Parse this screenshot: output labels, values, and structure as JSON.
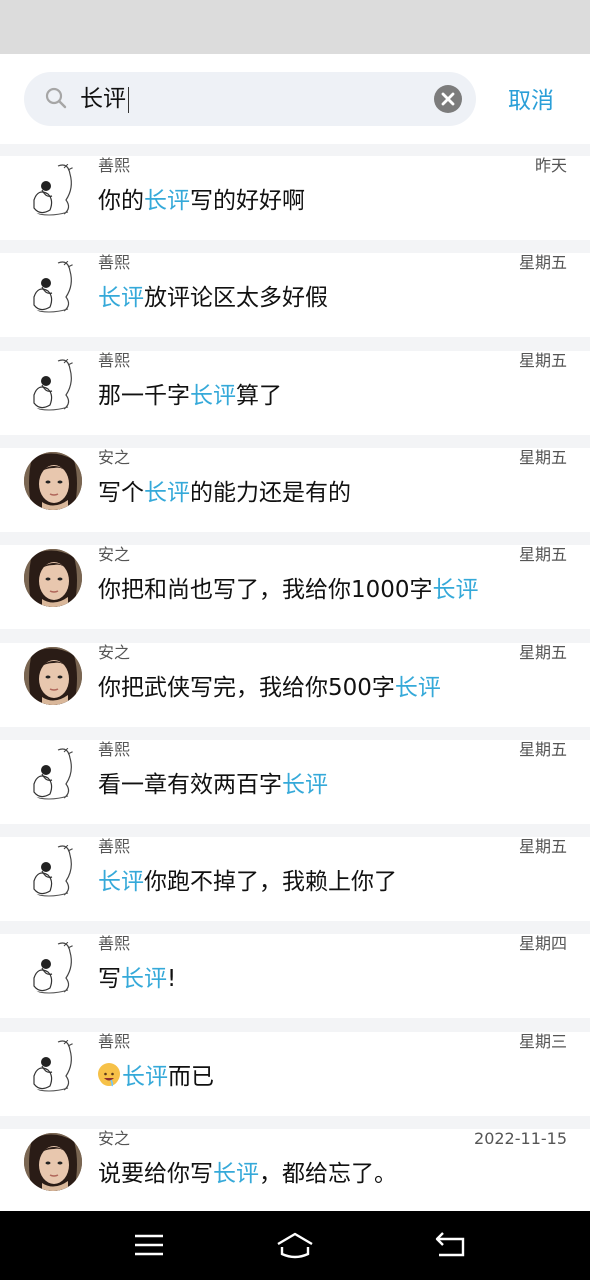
{
  "search": {
    "query": "长评",
    "cancel_label": "取消"
  },
  "colors": {
    "highlight": "#35a9d9",
    "accent": "#2a9fd8"
  },
  "results": [
    {
      "sender": "善熙",
      "avatar": "sketch",
      "time": "昨天",
      "parts": [
        [
          "你的",
          false
        ],
        [
          "长评",
          true
        ],
        [
          "写的好好啊",
          false
        ]
      ]
    },
    {
      "sender": "善熙",
      "avatar": "sketch",
      "time": "星期五",
      "parts": [
        [
          "长评",
          true
        ],
        [
          "放评论区太多好假",
          false
        ]
      ]
    },
    {
      "sender": "善熙",
      "avatar": "sketch",
      "time": "星期五",
      "parts": [
        [
          "那一千字",
          false
        ],
        [
          "长评",
          true
        ],
        [
          "算了",
          false
        ]
      ]
    },
    {
      "sender": "安之",
      "avatar": "photo",
      "time": "星期五",
      "parts": [
        [
          "写个",
          false
        ],
        [
          "长评",
          true
        ],
        [
          "的能力还是有的",
          false
        ]
      ]
    },
    {
      "sender": "安之",
      "avatar": "photo",
      "time": "星期五",
      "parts": [
        [
          "你把和尚也写了，我给你1000字",
          false
        ],
        [
          "长评",
          true
        ]
      ]
    },
    {
      "sender": "安之",
      "avatar": "photo",
      "time": "星期五",
      "parts": [
        [
          "你把武侠写完，我给你500字",
          false
        ],
        [
          "长评",
          true
        ]
      ]
    },
    {
      "sender": "善熙",
      "avatar": "sketch",
      "time": "星期五",
      "parts": [
        [
          "看一章有效两百字",
          false
        ],
        [
          "长评",
          true
        ]
      ]
    },
    {
      "sender": "善熙",
      "avatar": "sketch",
      "time": "星期五",
      "parts": [
        [
          "长评",
          true
        ],
        [
          "你跑不掉了，我赖上你了",
          false
        ]
      ]
    },
    {
      "sender": "善熙",
      "avatar": "sketch",
      "time": "星期四",
      "parts": [
        [
          "写",
          false
        ],
        [
          "长评",
          true
        ],
        [
          "!",
          false
        ]
      ]
    },
    {
      "sender": "善熙",
      "avatar": "sketch",
      "time": "星期三",
      "emoji": "drooling-face-icon",
      "parts": [
        [
          "长评",
          true
        ],
        [
          "而已",
          false
        ]
      ]
    },
    {
      "sender": "安之",
      "avatar": "photo",
      "time": "2022-11-15",
      "parts": [
        [
          "说要给你写",
          false
        ],
        [
          "长评",
          true
        ],
        [
          "，都给忘了。",
          false
        ]
      ]
    }
  ]
}
